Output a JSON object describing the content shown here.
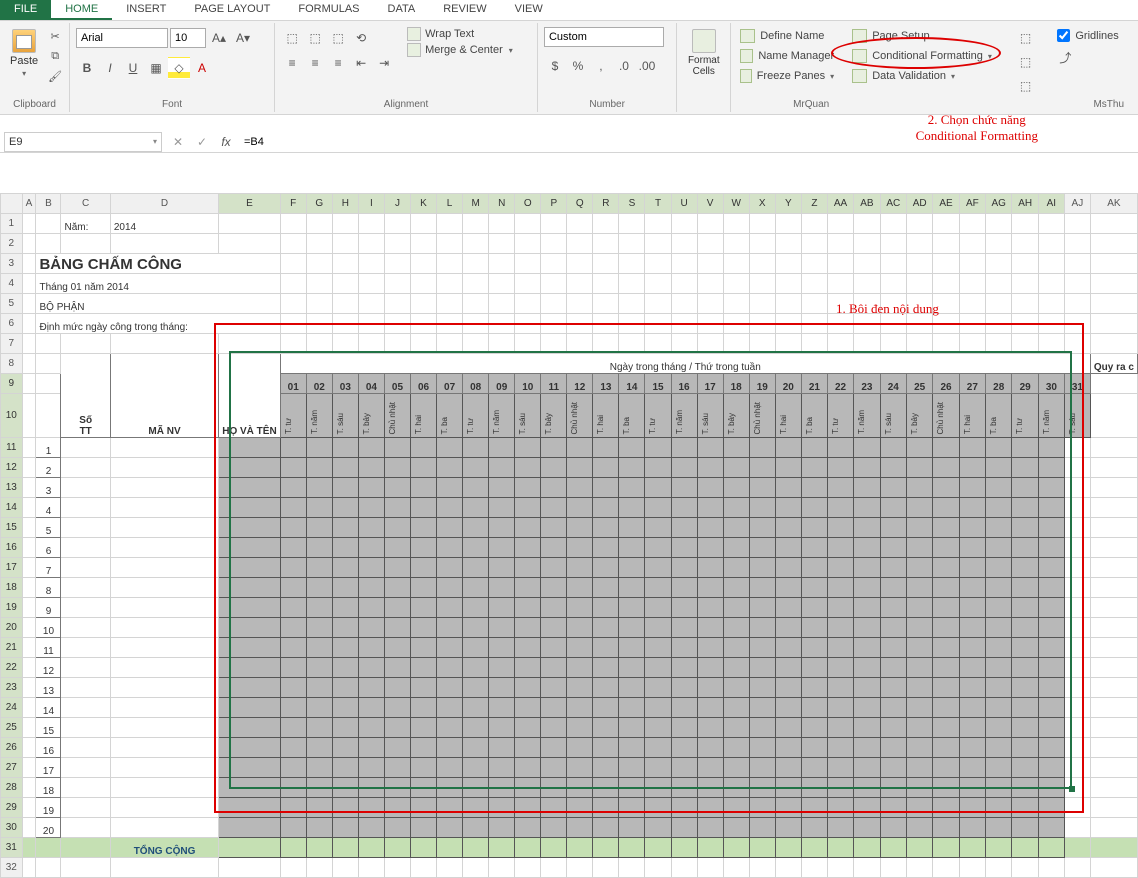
{
  "tabs": {
    "file": "FILE",
    "home": "HOME",
    "insert": "INSERT",
    "pagelayout": "PAGE LAYOUT",
    "formulas": "FORMULAS",
    "data": "DATA",
    "review": "REVIEW",
    "view": "VIEW"
  },
  "ribbon": {
    "clipboard": {
      "label": "Clipboard",
      "paste": "Paste"
    },
    "font": {
      "label": "Font",
      "name": "Arial",
      "size": "10"
    },
    "alignment": {
      "label": "Alignment",
      "wrap": "Wrap Text",
      "merge": "Merge & Center"
    },
    "number": {
      "label": "Number",
      "format": "Custom"
    },
    "cells": {
      "format": "Format\nCells"
    },
    "names": {
      "define": "Define Name",
      "manager": "Name Manager",
      "freeze": "Freeze Panes"
    },
    "pgsetup": "Page Setup",
    "condfmt": "Conditional Formatting",
    "dataval": "Data Validation",
    "gridlines": "Gridlines",
    "user1": "MrQuan",
    "user2": "MsThu"
  },
  "namebox": "E9",
  "formula": "=B4",
  "annotations": {
    "a1": "1. Bôi đen nội dung",
    "a2": "2. Chọn chức năng\nConditional Formatting"
  },
  "sheet": {
    "year_label": "Năm:",
    "year": "2014",
    "title": "BẢNG CHẤM CÔNG",
    "month": "Tháng 01 năm 2014",
    "dept": "BỘ PHẬN",
    "norm": "Định mức ngày công trong tháng:",
    "header_main": "Ngày trong tháng / Thứ trong tuần",
    "stt": "Số\nTT",
    "manv": "MÃ NV",
    "hoten": "HỌ VÀ TÊN",
    "quyra": "Quy ra c",
    "total": "TỔNG CỘNG",
    "cols": [
      "A",
      "B",
      "C",
      "D",
      "E",
      "F",
      "G",
      "H",
      "I",
      "J",
      "K",
      "L",
      "M",
      "N",
      "O",
      "P",
      "Q",
      "R",
      "S",
      "T",
      "U",
      "V",
      "W",
      "X",
      "Y",
      "Z",
      "AA",
      "AB",
      "AC",
      "AD",
      "AE",
      "AF",
      "AG",
      "AH",
      "AI",
      "AJ",
      "AK"
    ],
    "days": [
      "01",
      "02",
      "03",
      "04",
      "05",
      "06",
      "07",
      "08",
      "09",
      "10",
      "11",
      "12",
      "13",
      "14",
      "15",
      "16",
      "17",
      "18",
      "19",
      "20",
      "21",
      "22",
      "23",
      "24",
      "25",
      "26",
      "27",
      "28",
      "29",
      "30",
      "31"
    ],
    "weekdays": [
      "T. tư",
      "T. năm",
      "T. sáu",
      "T. bảy",
      "Chủ nhật",
      "T. hai",
      "T. ba",
      "T. tư",
      "T. năm",
      "T. sáu",
      "T. bảy",
      "Chủ nhật",
      "T. hai",
      "T. ba",
      "T. tư",
      "T. năm",
      "T. sáu",
      "T. bảy",
      "Chủ nhật",
      "T. hai",
      "T. ba",
      "T. tư",
      "T. năm",
      "T. sáu",
      "T. bảy",
      "Chủ nhật",
      "T. hai",
      "T. ba",
      "T. tư",
      "T. năm",
      "T. sáu"
    ]
  }
}
